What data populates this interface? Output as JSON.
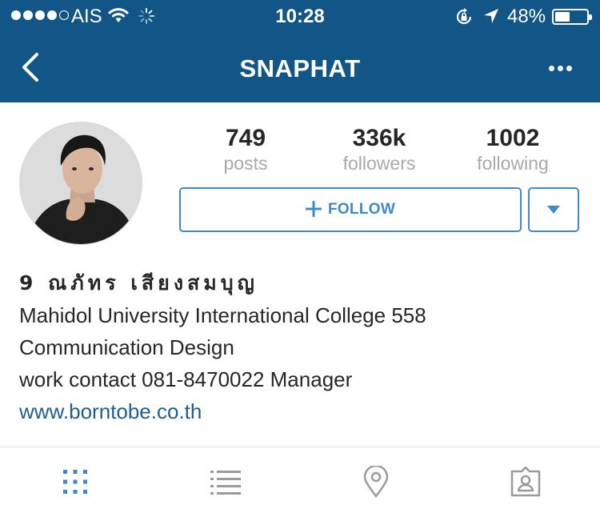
{
  "status_bar": {
    "carrier": "AIS",
    "time": "10:28",
    "battery_pct": "48%",
    "battery_level": 0.48,
    "icons": [
      "signal-dots",
      "wifi-icon",
      "activity-spinner-icon",
      "rotation-lock-icon",
      "location-arrow-icon",
      "battery-icon"
    ]
  },
  "nav": {
    "title": "SNAPHAT",
    "back_icon": "chevron-left-icon",
    "more_icon": "more-dots-icon"
  },
  "profile": {
    "avatar_icon": "profile-avatar",
    "stats": [
      {
        "value": "749",
        "label": "posts"
      },
      {
        "value": "336k",
        "label": "followers"
      },
      {
        "value": "1002",
        "label": "following"
      }
    ],
    "follow_label": "FOLLOW",
    "follow_icon": "plus-icon",
    "dropdown_icon": "caret-down-icon"
  },
  "bio": {
    "name": "9 ณภัทร เสียงสมบุญ",
    "lines": [
      "Mahidol University International College 558",
      "Communication Design",
      "work contact 081-8470022 Manager"
    ],
    "link": "www.borntobe.co.th"
  },
  "tabs": [
    {
      "icon": "grid-icon",
      "active": true
    },
    {
      "icon": "list-icon",
      "active": false
    },
    {
      "icon": "location-pin-icon",
      "active": false
    },
    {
      "icon": "tagged-photos-icon",
      "active": false
    }
  ],
  "colors": {
    "header_bg": "#125688",
    "accent": "#3f89cb",
    "link": "#1d5d93",
    "muted": "#a8a8a8",
    "tab_inactive": "#9a9a9a"
  }
}
